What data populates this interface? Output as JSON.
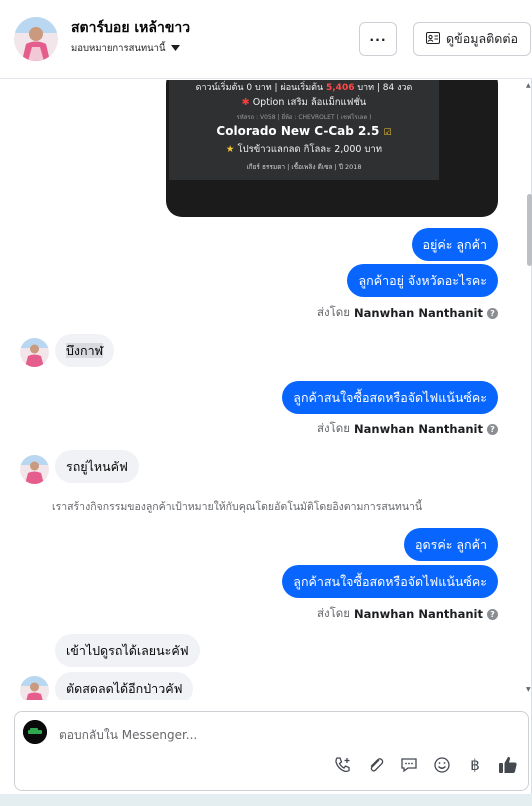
{
  "header": {
    "name": "สตาร์บอย เหล้าขาว",
    "assign_label": "มอบหมายการสนทนานี้",
    "more_label": "···",
    "contact_label": "ดูข้อมูลติดต่อ"
  },
  "card": {
    "line1_a": "ดาวน์เริ่มต้น 0 บาท | ผ่อนเริ่มต้น ",
    "line1_price": "5,406",
    "line1_b": " บาท | 84 งวด",
    "line2": "Option เสริม ล้อแม็กแฟชั่น",
    "line3": "รหัสรถ : V058 | ยี่ห้อ : CHEVROLET ( เชฟโรเลต )",
    "line4": "Colorado New C-Cab 2.5",
    "line5": "โปรข้าวแลกลด กิโลละ 2,000 บาท",
    "line6": "เกียร์ ธรรมดา  |  เชื้อเพลิง ดีเซล  |  ปี 2018"
  },
  "messages": {
    "out1": "อยู่ค่ะ ลูกค้า",
    "out2": "ลูกค้าอยู่ จังหวัดอะไรคะ",
    "sent_prefix": "ส่งโดย",
    "sent_by": "Nanwhan Nanthanit",
    "in1": "บึงกาฬ",
    "out3": "ลูกค้าสนใจซื้อสดหรือจัดไฟแน้นซ์คะ",
    "in2": "รถยู่ไหนคัฟ",
    "auto_note": "เราสร้างกิจกรรมของลูกค้าเป้าหมายให้กับคุณโดยอัตโนมัติโดยอิงตามการสนทนานี้",
    "out4": "อุดรค่ะ ลูกค้า",
    "out5": "ลูกค้าสนใจซื้อสดหรือจัดไฟแน้นซ์คะ",
    "in3": "เข้าไปดูรถได้เลยนะคัฟ",
    "in4": "ตัดสดลดได้อีกป่าวคัฟ"
  },
  "composer": {
    "placeholder": "ตอบกลับใน Messenger..."
  },
  "colors": {
    "accent": "#0866ff",
    "incoming_bubble": "#f0f2f5"
  }
}
